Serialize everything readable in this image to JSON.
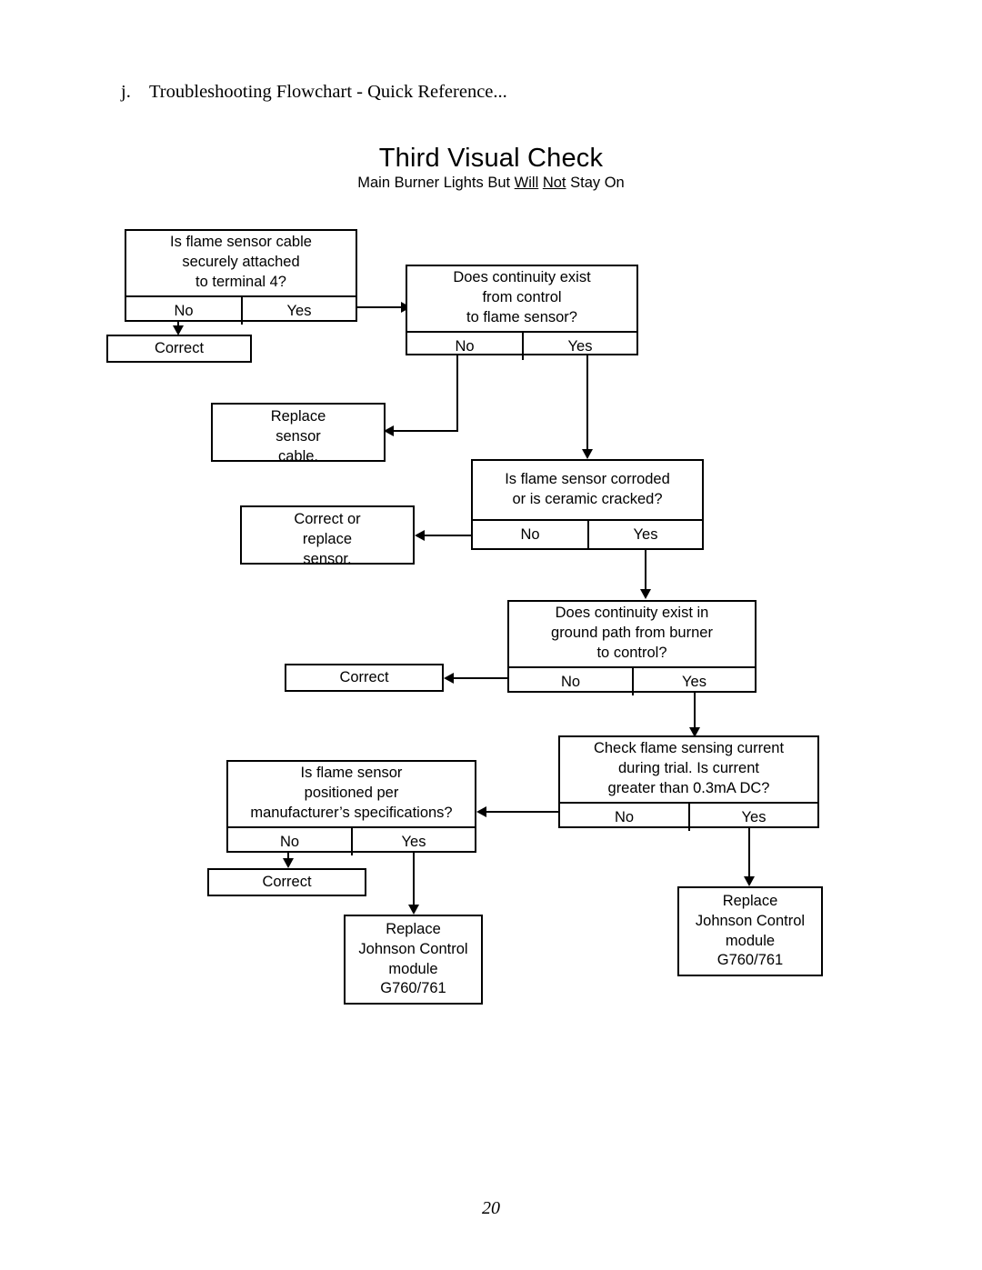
{
  "document": {
    "section_marker": "j.",
    "section_heading": "Troubleshooting Flowchart - Quick Reference...",
    "page_number": "20"
  },
  "chart": {
    "title": "Third Visual Check",
    "subtitle_part1": "Main Burner Lights But ",
    "subtitle_will": "Will",
    "subtitle_space1": " ",
    "subtitle_not": "Not",
    "subtitle_part2": " Stay On"
  },
  "answers": {
    "no": "No",
    "yes": "Yes"
  },
  "nodes": {
    "q1": {
      "prompt": "Is flame sensor cable\nsecurely attached\nto terminal 4?",
      "no": "No",
      "yes": "Yes"
    },
    "a1_correct": {
      "text": "Correct"
    },
    "q2": {
      "prompt": "Does continuity exist\nfrom control\nto flame sensor?",
      "no": "No",
      "yes": "Yes"
    },
    "a2_replace_cable": {
      "text": "Replace\nsensor\ncable."
    },
    "q3": {
      "prompt": "Is flame sensor corroded\nor is ceramic cracked?",
      "no": "No",
      "yes": "Yes"
    },
    "a3_correct_replace": {
      "text": "Correct or\nreplace\nsensor."
    },
    "q4": {
      "prompt": "Does continuity exist in\nground path from burner\nto control?",
      "no": "No",
      "yes": "Yes"
    },
    "a4_correct": {
      "text": "Correct"
    },
    "q5": {
      "prompt": "Check flame sensing current\nduring trial.  Is current\ngreater than 0.3mA DC?",
      "no": "No",
      "yes": "Yes"
    },
    "q6": {
      "prompt": "Is flame sensor\npositioned per\nmanufacturer’s specifications?",
      "no": "No",
      "yes": "Yes"
    },
    "a6_correct": {
      "text": "Correct"
    },
    "t1_replace_module": {
      "text": "Replace\nJohnson Control\nmodule\nG760/761"
    },
    "t2_replace_module": {
      "text": "Replace\nJohnson Control\nmodule\nG760/761"
    }
  },
  "chart_data": {
    "type": "diagram",
    "title": "Third Visual Check",
    "subtitle": "Main Burner Lights But Will Not Stay On",
    "flow": [
      {
        "id": "q1",
        "kind": "decision",
        "text": "Is flame sensor cable securely attached to terminal 4?",
        "branches": [
          {
            "label": "No",
            "target": "a1_correct"
          },
          {
            "label": "Yes",
            "target": "q2"
          }
        ]
      },
      {
        "id": "a1_correct",
        "kind": "action",
        "text": "Correct"
      },
      {
        "id": "q2",
        "kind": "decision",
        "text": "Does continuity exist from control to flame sensor?",
        "branches": [
          {
            "label": "No",
            "target": "a2_replace_cable"
          },
          {
            "label": "Yes",
            "target": "q3"
          }
        ]
      },
      {
        "id": "a2_replace_cable",
        "kind": "action",
        "text": "Replace sensor cable."
      },
      {
        "id": "q3",
        "kind": "decision",
        "text": "Is flame sensor corroded or is ceramic cracked?",
        "branches": [
          {
            "label": "No",
            "target": "q4"
          },
          {
            "label": "Yes",
            "target": "a3_correct_replace"
          }
        ]
      },
      {
        "id": "a3_correct_replace",
        "kind": "action",
        "text": "Correct or replace sensor."
      },
      {
        "id": "q4",
        "kind": "decision",
        "text": "Does continuity exist in ground path from burner to control?",
        "branches": [
          {
            "label": "No",
            "target": "a4_correct"
          },
          {
            "label": "Yes",
            "target": "q5"
          }
        ]
      },
      {
        "id": "a4_correct",
        "kind": "action",
        "text": "Correct"
      },
      {
        "id": "q5",
        "kind": "decision",
        "text": "Check flame sensing current during trial.  Is current greater than 0.3mA DC?",
        "branches": [
          {
            "label": "No",
            "target": "q6"
          },
          {
            "label": "Yes",
            "target": "t2_replace_module"
          }
        ]
      },
      {
        "id": "q6",
        "kind": "decision",
        "text": "Is flame sensor positioned per manufacturer’s specifications?",
        "branches": [
          {
            "label": "No",
            "target": "a6_correct"
          },
          {
            "label": "Yes",
            "target": "t1_replace_module"
          }
        ]
      },
      {
        "id": "a6_correct",
        "kind": "action",
        "text": "Correct"
      },
      {
        "id": "t1_replace_module",
        "kind": "terminal",
        "text": "Replace Johnson Control module G760/761"
      },
      {
        "id": "t2_replace_module",
        "kind": "terminal",
        "text": "Replace Johnson Control module G760/761"
      }
    ]
  }
}
